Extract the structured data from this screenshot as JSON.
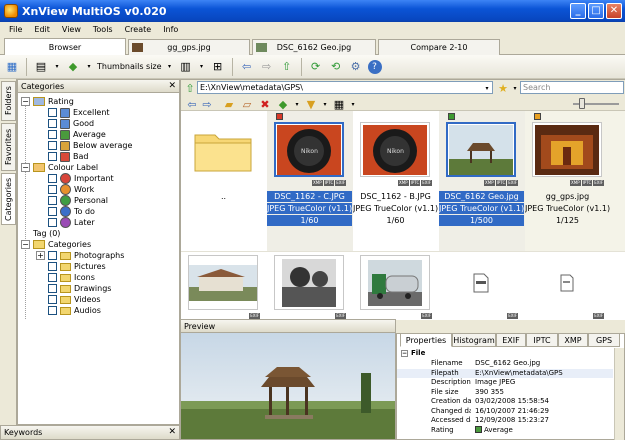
{
  "window": {
    "title": "XnView MultiOS v0.020"
  },
  "menu": [
    "File",
    "Edit",
    "View",
    "Tools",
    "Create",
    "Info"
  ],
  "tabs": [
    {
      "label": "Browser",
      "active": true
    },
    {
      "label": "gg_gps.jpg",
      "active": false
    },
    {
      "label": "DSC_6162 Geo.jpg",
      "active": false
    },
    {
      "label": "Compare 2-10",
      "active": false
    }
  ],
  "toolbar": {
    "thumbnails_label": "Thumbnails size"
  },
  "side_tabs": [
    "Folders",
    "Favorites",
    "Categories"
  ],
  "categories_panel": {
    "title": "Categories",
    "close": "✕",
    "items": [
      {
        "label": "Rating",
        "level": 1,
        "kind": "group"
      },
      {
        "label": "Excellent",
        "level": 2,
        "kind": "rating",
        "color": "#5b8cd6"
      },
      {
        "label": "Good",
        "level": 2,
        "kind": "rating",
        "color": "#5b8cd6"
      },
      {
        "label": "Average",
        "level": 2,
        "kind": "rating",
        "color": "#4a9a3d"
      },
      {
        "label": "Below average",
        "level": 2,
        "kind": "rating",
        "color": "#d8a33a"
      },
      {
        "label": "Bad",
        "level": 2,
        "kind": "rating",
        "color": "#d84a3a"
      },
      {
        "label": "Colour Label",
        "level": 1,
        "kind": "group"
      },
      {
        "label": "Important",
        "level": 2,
        "kind": "color",
        "color": "#d8453a"
      },
      {
        "label": "Work",
        "level": 2,
        "kind": "color",
        "color": "#e7902d"
      },
      {
        "label": "Personal",
        "level": 2,
        "kind": "color",
        "color": "#3f9d42"
      },
      {
        "label": "To do",
        "level": 2,
        "kind": "color",
        "color": "#3b6fc9"
      },
      {
        "label": "Later",
        "level": 2,
        "kind": "color",
        "color": "#9a4bb5"
      },
      {
        "label": "Tag (0)",
        "level": 1,
        "kind": "plain"
      },
      {
        "label": "Categories",
        "level": 1,
        "kind": "group"
      },
      {
        "label": "Photographs",
        "level": 2,
        "kind": "folder",
        "expandable": true
      },
      {
        "label": "Pictures",
        "level": 2,
        "kind": "folder"
      },
      {
        "label": "Icons",
        "level": 2,
        "kind": "folder"
      },
      {
        "label": "Drawings",
        "level": 2,
        "kind": "folder"
      },
      {
        "label": "Videos",
        "level": 2,
        "kind": "folder"
      },
      {
        "label": "Audios",
        "level": 2,
        "kind": "folder"
      }
    ]
  },
  "keywords_panel": {
    "title": "Keywords",
    "close": "✕"
  },
  "browser": {
    "path": "E:\\XnView\\metadata\\GPS\\",
    "search_placeholder": "Search",
    "thumbnails": [
      {
        "name": "..",
        "type": "",
        "info": "",
        "selected": false,
        "kind": "folder"
      },
      {
        "name": "DSC_1162 - C.JPG",
        "type": "JPEG TrueColor (v1.1)",
        "info": "1/60",
        "selected": true,
        "kind": "nikon",
        "badge": "#d83a2a"
      },
      {
        "name": "DSC_1162 - B.JPG",
        "type": "JPEG TrueColor (v1.1)",
        "info": "1/60",
        "selected": false,
        "kind": "nikon"
      },
      {
        "name": "DSC_6162 Geo.jpg",
        "type": "JPEG TrueColor (v1.1)",
        "info": "1/500",
        "selected": true,
        "kind": "pavilion",
        "badge": "#3d9a30"
      },
      {
        "name": "gg_gps.jpg",
        "type": "JPEG TrueColor (v1.1)",
        "info": "1/125",
        "selected": false,
        "kind": "temple",
        "badge": "#e8a020"
      },
      {
        "name": "",
        "type": "",
        "info": "",
        "selected": false,
        "kind": "house"
      },
      {
        "name": "",
        "type": "",
        "info": "",
        "selected": false,
        "kind": "bw"
      },
      {
        "name": "",
        "type": "",
        "info": "",
        "selected": false,
        "kind": "truck"
      },
      {
        "name": "",
        "type": "",
        "info": "",
        "selected": false,
        "kind": "file"
      },
      {
        "name": "",
        "type": "",
        "info": "",
        "selected": false,
        "kind": "file2"
      }
    ],
    "exif_badges": [
      "XMP",
      "IPTC",
      "EXIF"
    ]
  },
  "preview_panel": {
    "title": "Preview"
  },
  "properties": {
    "tabs": [
      "Properties",
      "Histogram",
      "EXIF",
      "IPTC",
      "XMP",
      "GPS"
    ],
    "section": "File",
    "rows": [
      {
        "k": "Filename",
        "v": "DSC_6162 Geo.jpg"
      },
      {
        "k": "Filepath",
        "v": "E:\\XnView\\metadata\\GPS"
      },
      {
        "k": "Description",
        "v": "Image JPEG"
      },
      {
        "k": "File size",
        "v": "390 355"
      },
      {
        "k": "Creation date/time",
        "v": "03/02/2008 15:58:54"
      },
      {
        "k": "Changed date/time",
        "v": "16/10/2007 21:46:29"
      },
      {
        "k": "Accessed date/time",
        "v": "12/09/2008 15:23:27"
      },
      {
        "k": "Rating",
        "v": "Average"
      }
    ]
  }
}
